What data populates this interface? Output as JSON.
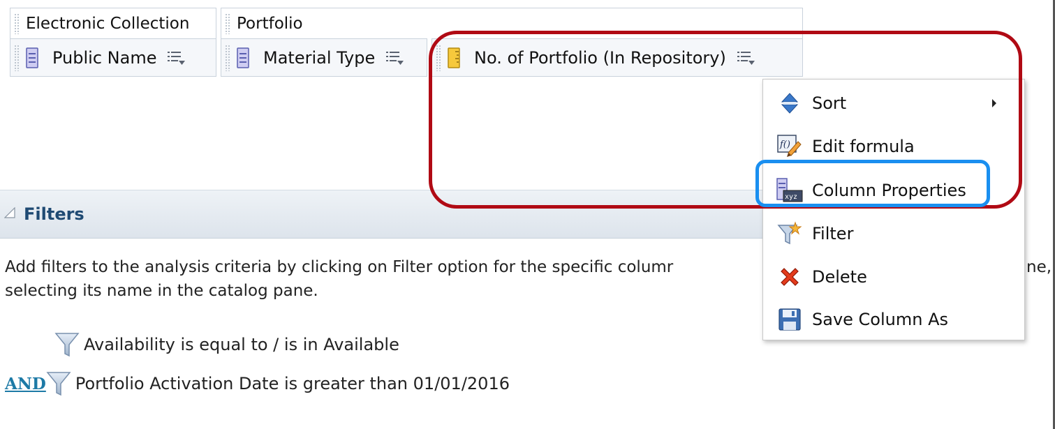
{
  "criteria": {
    "folders": [
      {
        "label": "Electronic Collection"
      },
      {
        "label": "Portfolio"
      }
    ],
    "columns": [
      {
        "label": "Public Name",
        "icon": "attribute-column-icon"
      },
      {
        "label": "Material Type",
        "icon": "attribute-column-icon"
      },
      {
        "label": "No. of Portfolio (In Repository)",
        "icon": "measure-column-icon"
      }
    ]
  },
  "context_menu": {
    "items": [
      {
        "label": "Sort",
        "icon": "sort-icon",
        "has_submenu": true
      },
      {
        "label": "Edit formula",
        "icon": "edit-formula-icon"
      },
      {
        "label": "Column Properties",
        "icon": "column-properties-icon"
      },
      {
        "label": "Filter",
        "icon": "filter-icon"
      },
      {
        "label": "Delete",
        "icon": "delete-icon"
      },
      {
        "label": "Save Column As",
        "icon": "save-icon"
      }
    ]
  },
  "filters": {
    "title": "Filters",
    "help_line1": "Add filters to the analysis criteria by clicking on Filter option for the specific columr",
    "help_line1_tail": "ne,",
    "help_line2": "selecting its name in the catalog pane.",
    "rows": [
      {
        "text": "Availability is equal to / is in  Available"
      },
      {
        "operator": "AND",
        "text": "Portfolio Activation Date  is greater than  01/01/2016"
      }
    ]
  },
  "colors": {
    "highlight_red": "#b00a14",
    "highlight_blue": "#1a8ff0",
    "filters_title": "#1f4a73",
    "and_link": "#1d7aa6"
  }
}
